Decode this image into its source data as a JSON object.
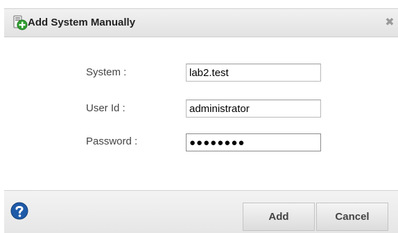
{
  "dialog": {
    "title": "Add System Manually",
    "close_glyph": "✖",
    "title_icon": "add-system-icon"
  },
  "form": {
    "system": {
      "label": "System :",
      "value": "lab2.test"
    },
    "user_id": {
      "label": "User Id :",
      "value": "administrator"
    },
    "password": {
      "label": "Password :",
      "value": "●●●●●●●●"
    }
  },
  "footer": {
    "help_icon": "help-icon",
    "add_label": "Add",
    "cancel_label": "Cancel"
  },
  "colors": {
    "help_icon": "#1e5aa8",
    "title_icon_plus": "#2f9e2f"
  }
}
